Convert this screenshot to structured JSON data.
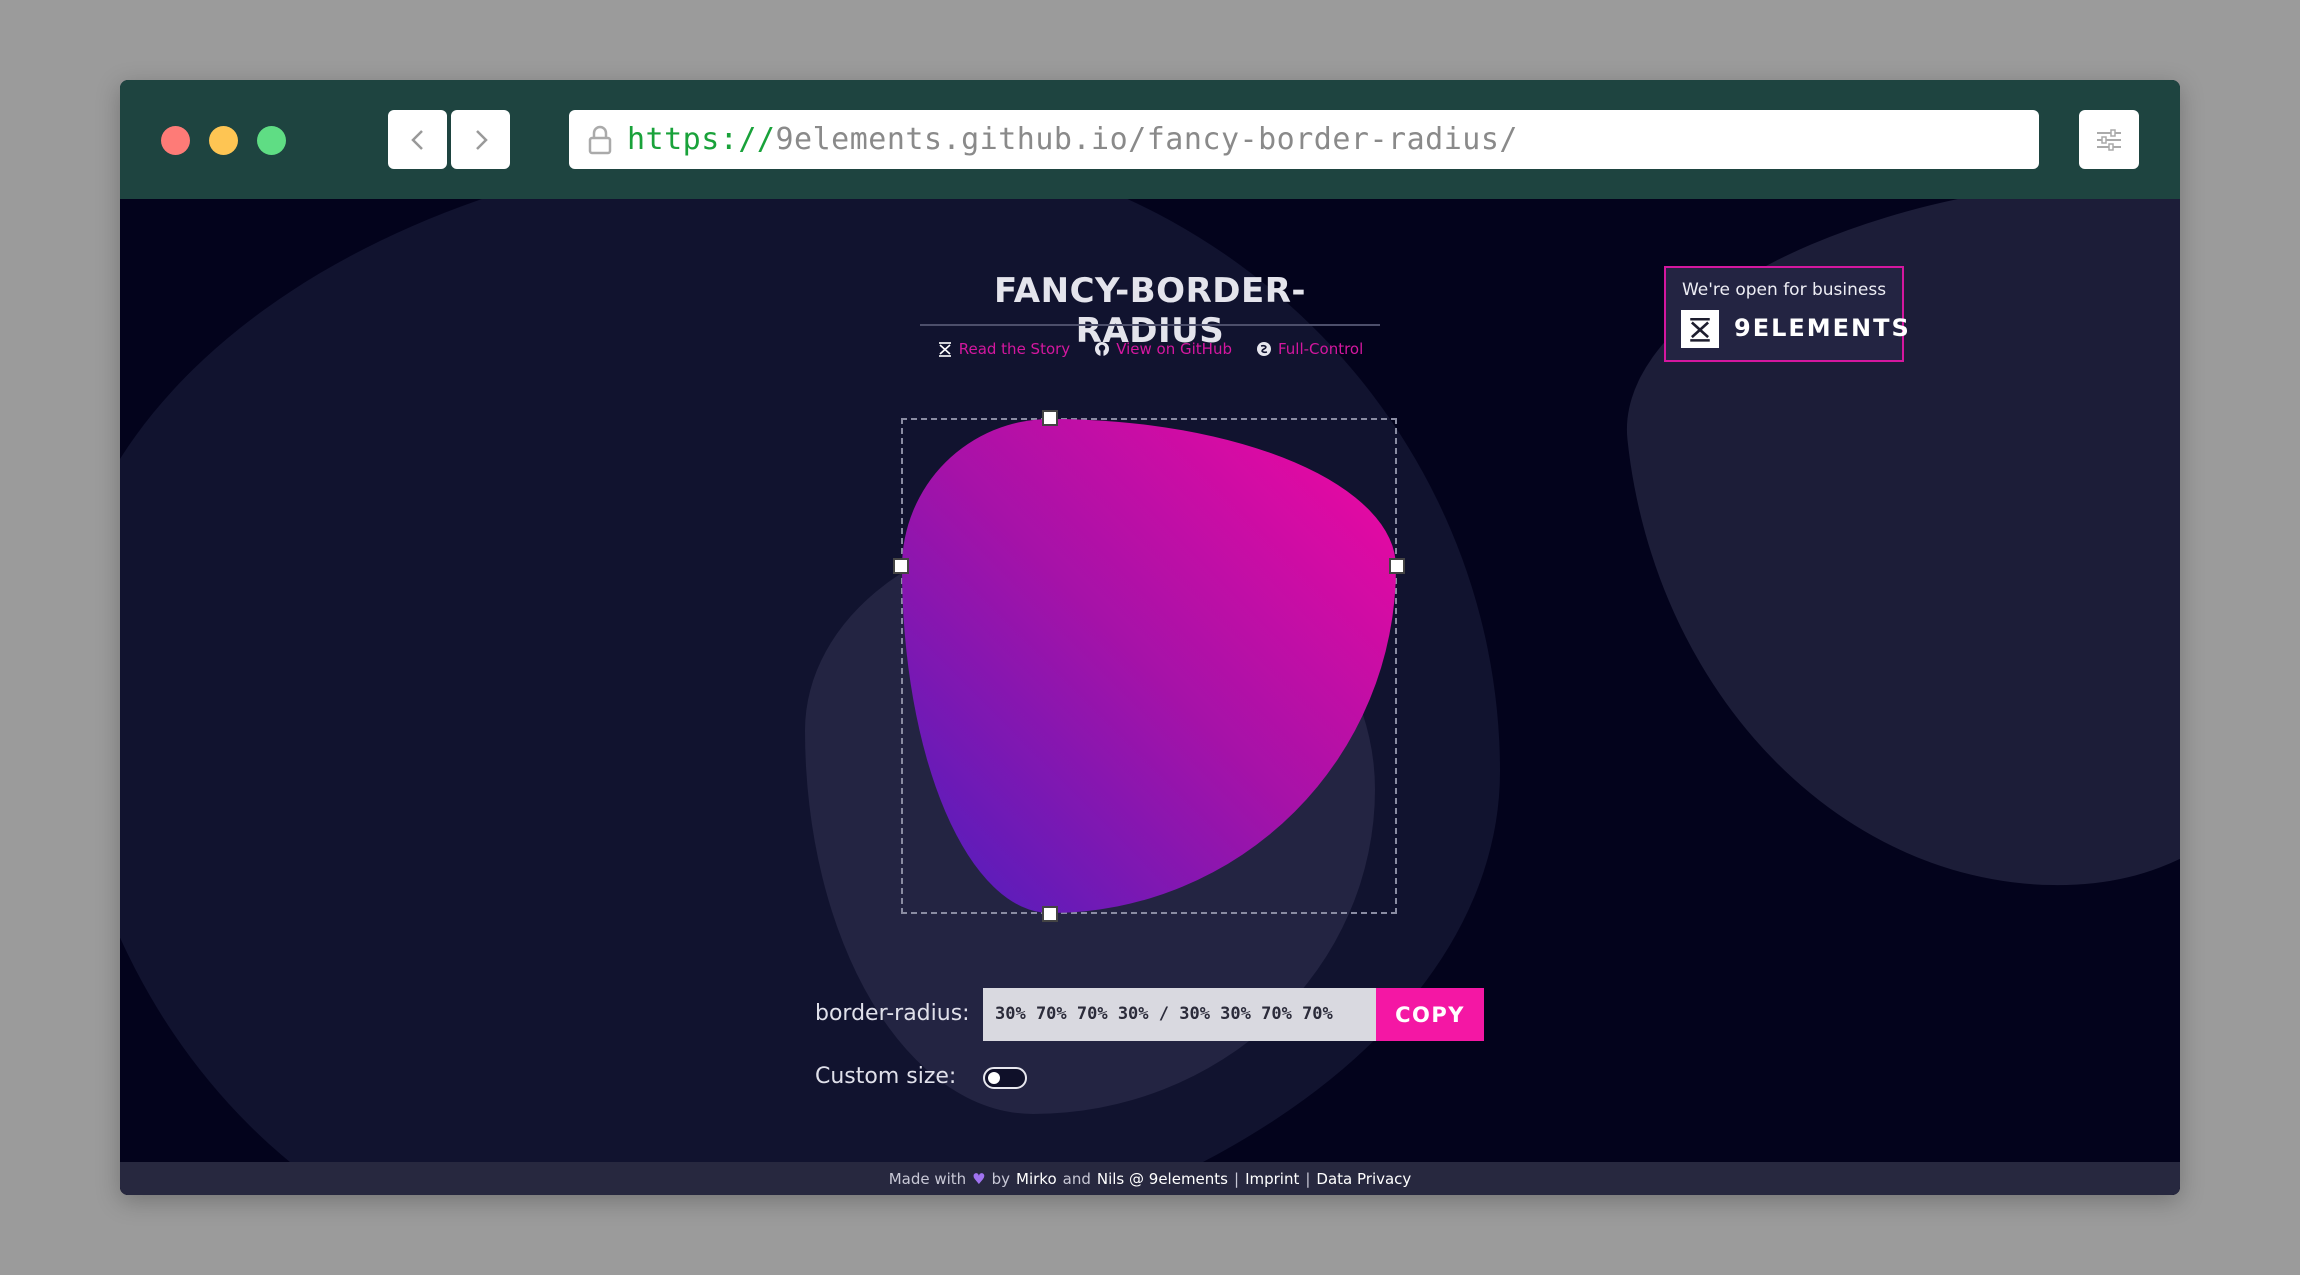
{
  "browser": {
    "url_protocol": "https://",
    "url_rest": "9elements.github.io/fancy-border-radius/"
  },
  "page": {
    "title": "FANCY-BORDER-RADIUS",
    "links": {
      "story": "Read the Story",
      "github": "View on GitHub",
      "full_control": "Full-Control"
    },
    "business_badge": {
      "tagline": "We're open for business",
      "brand": "9ELEMENTS"
    },
    "shape": {
      "border_radius": "30% 70% 70% 30% / 30% 30% 70% 70%",
      "gradient": [
        "#4a1fbf",
        "#a612a8",
        "#f307a1"
      ]
    },
    "controls": {
      "border_radius_label": "border-radius:",
      "border_radius_value": "30% 70% 70% 30% / 30% 30% 70% 70%",
      "copy_label": "COPY",
      "custom_size_label": "Custom size:",
      "custom_size_on": false
    },
    "footer": {
      "made_with": "Made with",
      "by": "by",
      "mirko": "Mirko",
      "and": "and",
      "nils": "Nils @ 9elements",
      "sep1": "|",
      "imprint": "Imprint",
      "sep2": "|",
      "privacy": "Data Privacy"
    }
  },
  "colors": {
    "accent": "#f417a4",
    "link": "#d4179f",
    "chrome": "#1e4440",
    "page_bg": "#03031c"
  },
  "icons": [
    "back-arrow-icon",
    "forward-arrow-icon",
    "lock-icon",
    "sliders-icon",
    "9elements-logo-icon",
    "github-icon",
    "full-control-icon",
    "heart-icon"
  ]
}
